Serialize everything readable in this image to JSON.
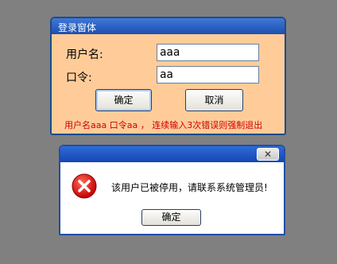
{
  "login": {
    "title": "登录窗体",
    "username_label": "用户名:",
    "password_label": "口令:",
    "username_value": "aaa",
    "password_value": "aa",
    "ok_button": "确定",
    "cancel_button": "取消",
    "warning_text": "用户名aaa 口令aa ， 连续输入3次错误则强制退出"
  },
  "dialog": {
    "close_glyph": "✕",
    "message": "该用户已被停用，请联系系统管理员!",
    "ok_button": "确定"
  },
  "colors": {
    "desktop": "#808080",
    "form_background": "#ffcc99",
    "title_bar": "#1c4fb0",
    "warning_text": "#cc0000"
  }
}
